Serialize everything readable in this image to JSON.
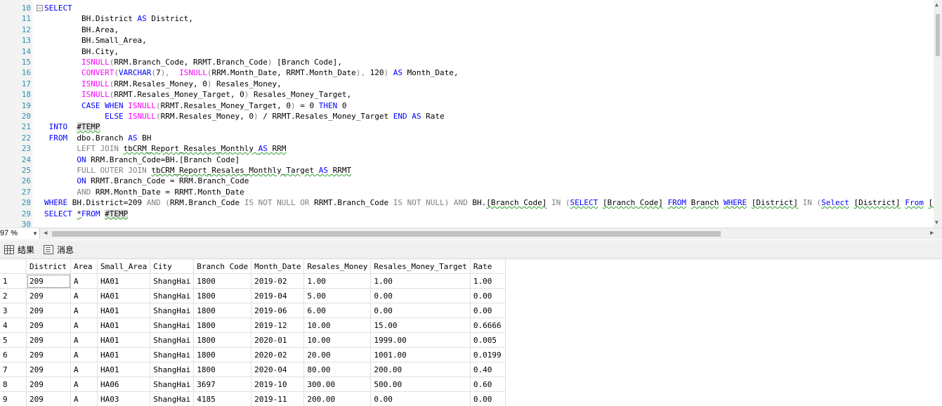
{
  "editor": {
    "lines": [
      {
        "n": "10",
        "segs": [
          [
            "kw",
            "SELECT"
          ]
        ],
        "fold": true
      },
      {
        "n": "11",
        "segs": [
          [
            "",
            "        BH.District "
          ],
          [
            "kw",
            "AS"
          ],
          [
            "",
            " District,"
          ]
        ]
      },
      {
        "n": "12",
        "segs": [
          [
            "",
            "        BH.Area,"
          ]
        ]
      },
      {
        "n": "13",
        "segs": [
          [
            "",
            "        BH.Small_Area,"
          ]
        ]
      },
      {
        "n": "14",
        "segs": [
          [
            "",
            "        BH.City,"
          ]
        ]
      },
      {
        "n": "15",
        "segs": [
          [
            "",
            "        "
          ],
          [
            "fn",
            "ISNULL"
          ],
          [
            "gr",
            "("
          ],
          [
            "",
            "RRM.Branch_Code, RRMT.Branch_Code"
          ],
          [
            "gr",
            ")"
          ],
          [
            "",
            " [Branch Code],"
          ]
        ]
      },
      {
        "n": "16",
        "segs": [
          [
            "",
            "        "
          ],
          [
            "fn",
            "CONVERT"
          ],
          [
            "gr",
            "("
          ],
          [
            "kw",
            "VARCHAR"
          ],
          [
            "gr",
            "("
          ],
          [
            "",
            "7"
          ],
          [
            "gr",
            "),"
          ],
          [
            "",
            "  "
          ],
          [
            "fn",
            "ISNULL"
          ],
          [
            "gr",
            "("
          ],
          [
            "",
            "RRM.Month_Date, RRMT.Month_Date"
          ],
          [
            "gr",
            "),"
          ],
          [
            "",
            " 120"
          ],
          [
            "gr",
            ")"
          ],
          [
            "",
            ""
          ],
          [
            "kw",
            " AS"
          ],
          [
            "",
            " Month_Date,"
          ]
        ]
      },
      {
        "n": "17",
        "segs": [
          [
            "",
            "        "
          ],
          [
            "fn",
            "ISNULL"
          ],
          [
            "gr",
            "("
          ],
          [
            "",
            "RRM.Resales_Money, 0"
          ],
          [
            "gr",
            ")"
          ],
          [
            "",
            " Resales_Money,"
          ]
        ]
      },
      {
        "n": "18",
        "segs": [
          [
            "",
            "        "
          ],
          [
            "fn",
            "ISNULL"
          ],
          [
            "gr",
            "("
          ],
          [
            "",
            "RRMT.Resales_Money_Target, 0"
          ],
          [
            "gr",
            ")"
          ],
          [
            "",
            " Resales_Money_Target,"
          ]
        ]
      },
      {
        "n": "19",
        "segs": [
          [
            "",
            "        "
          ],
          [
            "kw",
            "CASE WHEN "
          ],
          [
            "fn",
            "ISNULL"
          ],
          [
            "gr",
            "("
          ],
          [
            "",
            "RRMT.Resales_Money_Target, 0"
          ],
          [
            "gr",
            ")"
          ],
          [
            "",
            " = 0 "
          ],
          [
            "kw",
            "THEN"
          ],
          [
            "",
            " 0"
          ]
        ]
      },
      {
        "n": "20",
        "segs": [
          [
            "",
            "             "
          ],
          [
            "kw",
            "ELSE "
          ],
          [
            "fn",
            "ISNULL"
          ],
          [
            "gr",
            "("
          ],
          [
            "",
            "RRM.Resales_Money, 0"
          ],
          [
            "gr",
            ")"
          ],
          [
            "",
            " / RRMT.Resales_Money_Target "
          ],
          [
            "kw",
            "END AS"
          ],
          [
            "",
            " Rate"
          ]
        ]
      },
      {
        "n": "21",
        "segs": [
          [
            "kw",
            " INTO"
          ],
          [
            "",
            "  "
          ],
          [
            "temp",
            "#TEMP"
          ]
        ]
      },
      {
        "n": "22",
        "segs": [
          [
            "kw",
            " FROM"
          ],
          [
            "",
            "  dbo.Branch "
          ],
          [
            "kw",
            "AS"
          ],
          [
            "",
            " BH"
          ]
        ]
      },
      {
        "n": "23",
        "segs": [
          [
            "",
            "       "
          ],
          [
            "gr",
            "LEFT JOIN"
          ],
          [
            "",
            " "
          ],
          [
            "wavy",
            "tbCRM_Report_Resales_Monthly "
          ],
          [
            "kwwavy",
            "AS"
          ],
          [
            "wavy",
            " RRM"
          ]
        ]
      },
      {
        "n": "24",
        "segs": [
          [
            "",
            "       "
          ],
          [
            "kw",
            "ON"
          ],
          [
            "",
            " RRM.Branch_Code=BH.[Branch Code]"
          ]
        ]
      },
      {
        "n": "25",
        "segs": [
          [
            "",
            "       "
          ],
          [
            "gr",
            "FULL OUTER JOIN"
          ],
          [
            "",
            " "
          ],
          [
            "wavy",
            "tbCRM_Report_Resales_Monthly_Target "
          ],
          [
            "kwwavy",
            "AS"
          ],
          [
            "wavy",
            " RRMT"
          ]
        ]
      },
      {
        "n": "26",
        "segs": [
          [
            "",
            "       "
          ],
          [
            "kw",
            "ON"
          ],
          [
            "",
            " RRMT.Branch_Code = RRM.Branch_Code"
          ]
        ]
      },
      {
        "n": "27",
        "segs": [
          [
            "",
            "       "
          ],
          [
            "gr",
            "AND"
          ],
          [
            "",
            " RRM.Month_Date = RRMT.Month_Date"
          ]
        ]
      },
      {
        "n": "28",
        "segs": [
          [
            "kw",
            "WHERE"
          ],
          [
            "",
            " BH.District=209 "
          ],
          [
            "gr",
            "AND"
          ],
          [
            "",
            " "
          ],
          [
            "gr",
            "("
          ],
          [
            "",
            "RRM.Branch_Code "
          ],
          [
            "gr",
            "IS NOT NULL OR"
          ],
          [
            "",
            " RRMT.Branch_Code "
          ],
          [
            "gr",
            "IS NOT NULL"
          ],
          [
            "gr",
            ")"
          ],
          [
            "",
            " "
          ],
          [
            "gr",
            "AND"
          ],
          [
            "",
            " BH."
          ],
          [
            "wavy",
            "[Branch Code]"
          ],
          [
            "",
            " "
          ],
          [
            "gr",
            "IN"
          ],
          [
            "",
            " "
          ],
          [
            "gr",
            "("
          ],
          [
            "kwwavy",
            "SELECT"
          ],
          [
            "",
            " "
          ],
          [
            "wavy",
            "[Branch Code]"
          ],
          [
            "",
            " "
          ],
          [
            "kwwavy",
            "FROM"
          ],
          [
            "",
            " "
          ],
          [
            "wavy",
            "Branch"
          ],
          [
            "",
            " "
          ],
          [
            "kwwavy",
            "WHERE"
          ],
          [
            "",
            " "
          ],
          [
            "wavy",
            "[District]"
          ],
          [
            "",
            " "
          ],
          [
            "gr",
            "IN"
          ],
          [
            "",
            " "
          ],
          [
            "gr",
            "("
          ],
          [
            "kwwavy",
            "Select"
          ],
          [
            "",
            " "
          ],
          [
            "wavy",
            "[District]"
          ],
          [
            "",
            " "
          ],
          [
            "kwwavy",
            "From"
          ],
          [
            "",
            " "
          ],
          [
            "wavy",
            "[Branch POS]"
          ]
        ]
      },
      {
        "n": "29",
        "segs": [
          [
            "kw",
            "SELECT"
          ],
          [
            "",
            " "
          ],
          [
            "wavy",
            "*"
          ],
          [
            "kw",
            "FROM"
          ],
          [
            "",
            " "
          ],
          [
            "temp",
            "#TEMP"
          ]
        ]
      },
      {
        "n": "30",
        "segs": []
      }
    ]
  },
  "status": {
    "zoom": "97 %"
  },
  "tabs": {
    "results": "结果",
    "messages": "消息"
  },
  "results": {
    "columns": [
      "",
      "District",
      "Area",
      "Small_Area",
      "City",
      "Branch Code",
      "Month_Date",
      "Resales_Money",
      "Resales_Money_Target",
      "Rate"
    ],
    "rows": [
      [
        "1",
        "209",
        "A",
        "HA01",
        "ShangHai",
        "1800",
        "2019-02",
        "1.00",
        "1.00",
        "1.00"
      ],
      [
        "2",
        "209",
        "A",
        "HA01",
        "ShangHai",
        "1800",
        "2019-04",
        "5.00",
        "0.00",
        "0.00"
      ],
      [
        "3",
        "209",
        "A",
        "HA01",
        "ShangHai",
        "1800",
        "2019-06",
        "6.00",
        "0.00",
        "0.00"
      ],
      [
        "4",
        "209",
        "A",
        "HA01",
        "ShangHai",
        "1800",
        "2019-12",
        "10.00",
        "15.00",
        "0.6666"
      ],
      [
        "5",
        "209",
        "A",
        "HA01",
        "ShangHai",
        "1800",
        "2020-01",
        "10.00",
        "1999.00",
        "0.005"
      ],
      [
        "6",
        "209",
        "A",
        "HA01",
        "ShangHai",
        "1800",
        "2020-02",
        "20.00",
        "1001.00",
        "0.0199"
      ],
      [
        "7",
        "209",
        "A",
        "HA01",
        "ShangHai",
        "1800",
        "2020-04",
        "80.00",
        "200.00",
        "0.40"
      ],
      [
        "8",
        "209",
        "A",
        "HA06",
        "ShangHai",
        "3697",
        "2019-10",
        "300.00",
        "500.00",
        "0.60"
      ],
      [
        "9",
        "209",
        "A",
        "HA03",
        "ShangHai",
        "4185",
        "2019-11",
        "200.00",
        "0.00",
        "0.00"
      ]
    ]
  }
}
